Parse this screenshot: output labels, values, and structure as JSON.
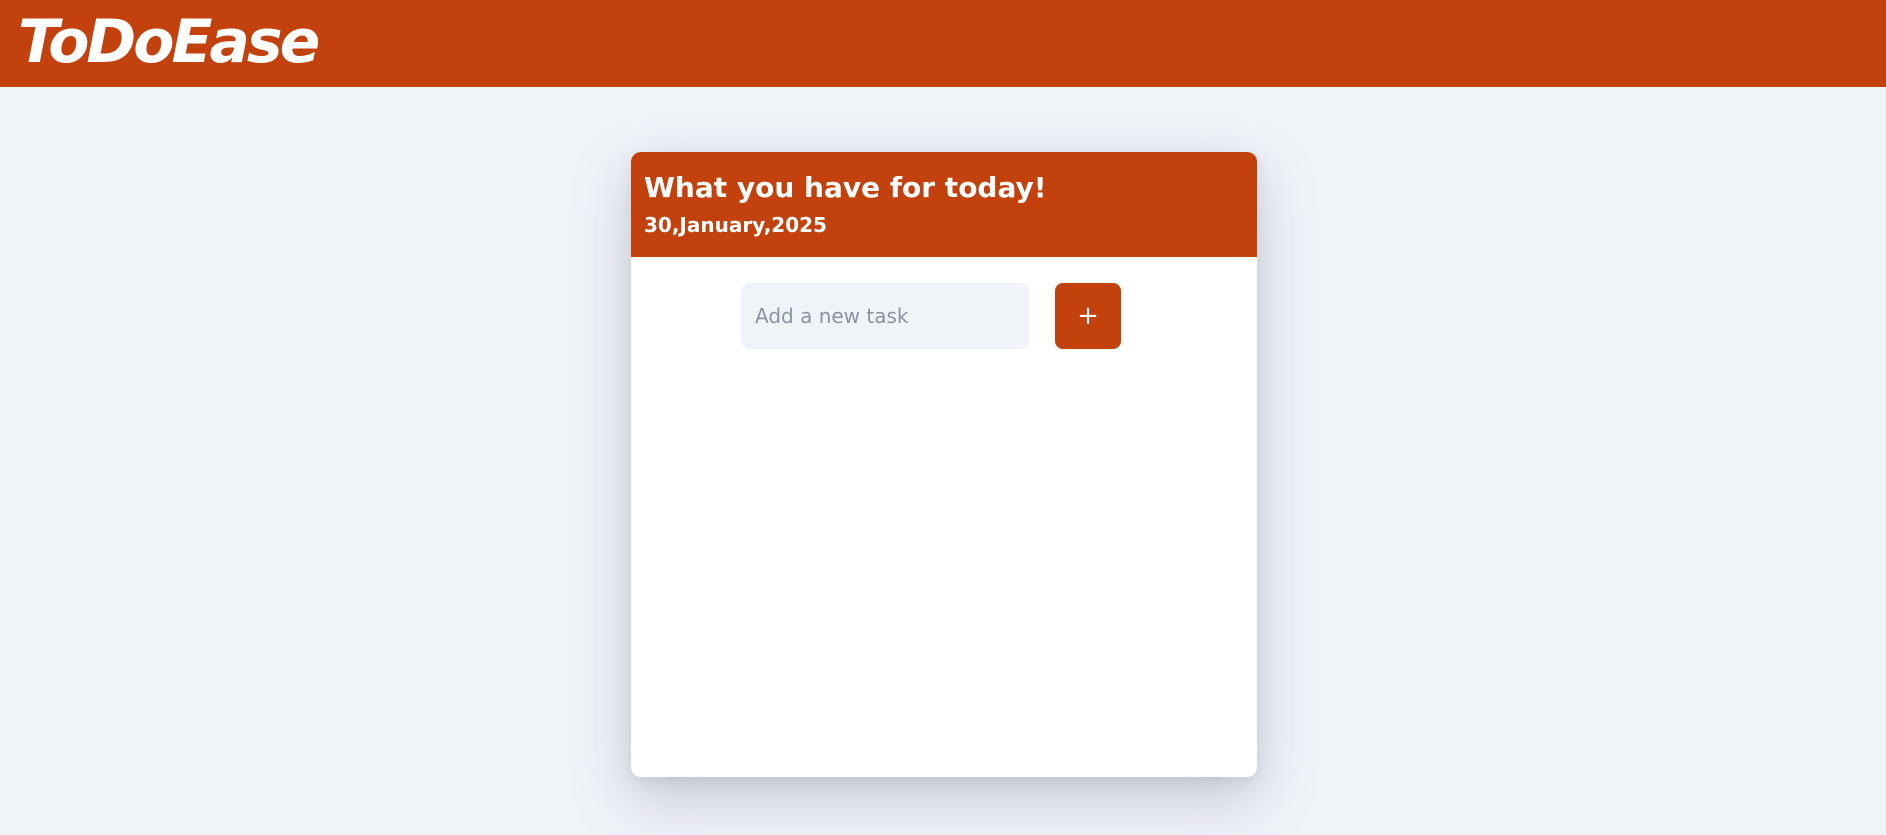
{
  "app": {
    "brand": "ToDoEase"
  },
  "card": {
    "title": "What you have for today!",
    "date": "30,January,2025"
  },
  "task_form": {
    "input_value": "",
    "input_placeholder": "Add a new task",
    "add_button_label": "+"
  },
  "tasks": [],
  "colors": {
    "accent": "#c2410c",
    "background": "#f0f3f8",
    "card": "#ffffff"
  }
}
